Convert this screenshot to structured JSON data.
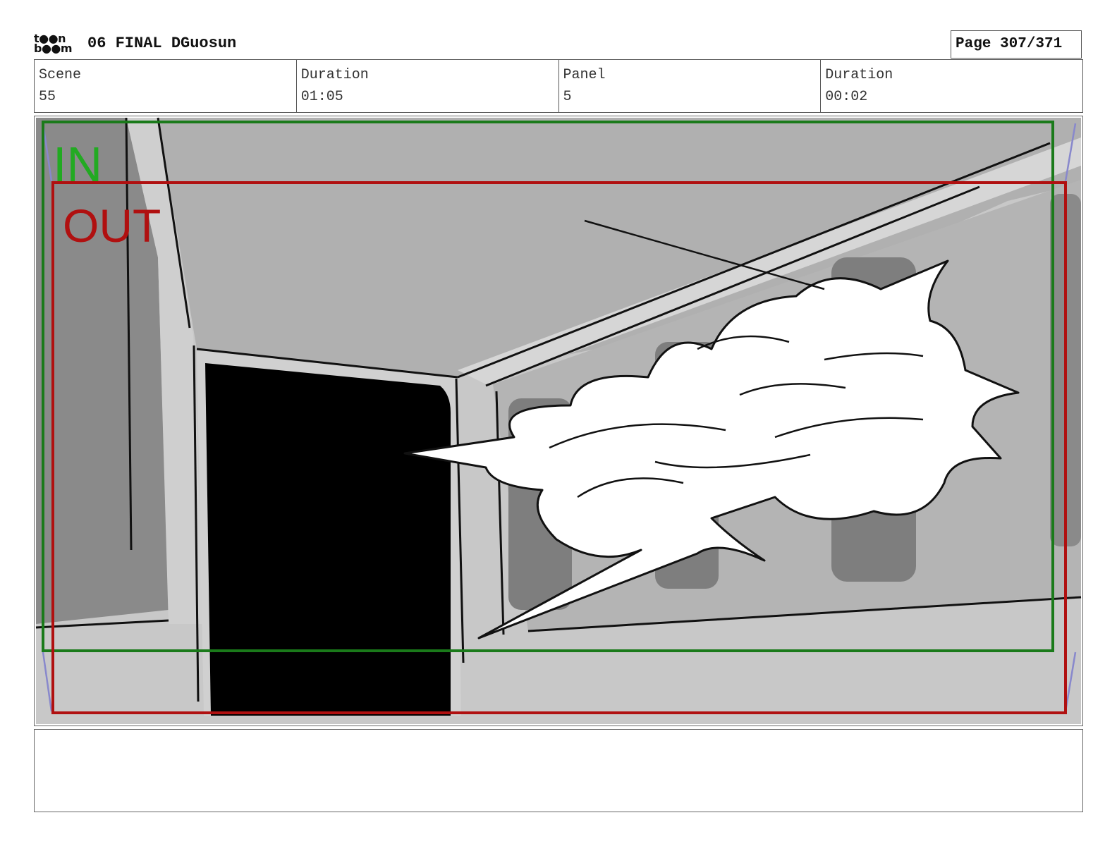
{
  "header": {
    "logo_top": "t●●n",
    "logo_bottom": "b●●m",
    "title": "06 FINAL DGuosun",
    "page": "Page 307/371"
  },
  "info": [
    {
      "label": "Scene",
      "value": "55"
    },
    {
      "label": "Duration",
      "value": "01:05"
    },
    {
      "label": "Panel",
      "value": "5"
    },
    {
      "label": "Duration",
      "value": "00:02"
    }
  ],
  "panel": {
    "in_label": "IN",
    "out_label": "OUT",
    "in_color": "#1a7a1a",
    "out_color": "#b01010",
    "label_in_color": "#22aa22",
    "label_out_color": "#b01010"
  },
  "notes": {
    "text": ""
  }
}
